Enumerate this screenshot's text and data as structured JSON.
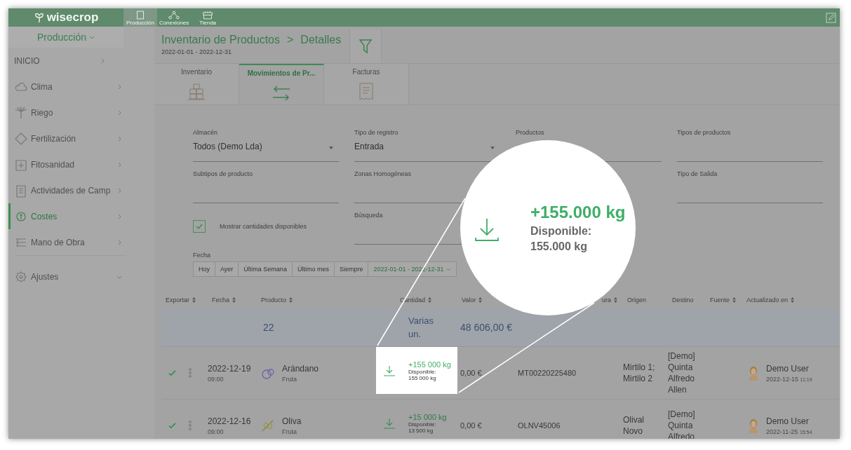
{
  "app": {
    "logo": "wisecrop"
  },
  "top_nav": [
    {
      "label": "Producción",
      "selected": true
    },
    {
      "label": "Conexiones",
      "selected": false
    },
    {
      "label": "Tienda",
      "selected": false
    }
  ],
  "sidebar": {
    "section": "Producción",
    "items": [
      {
        "label": "INICIO",
        "kind": "page",
        "selected": false
      },
      {
        "label": "Clima",
        "kind": "page",
        "selected": false
      },
      {
        "label": "Riego",
        "kind": "page",
        "selected": false
      },
      {
        "label": "Fertilización",
        "kind": "page",
        "selected": false
      },
      {
        "label": "Fitosanidad",
        "kind": "page",
        "selected": false
      },
      {
        "label": "Actividades de Camp",
        "kind": "page",
        "selected": false
      },
      {
        "label": "Costes",
        "kind": "page",
        "selected": true
      },
      {
        "label": "Mano de Obra",
        "kind": "page",
        "selected": false
      },
      {
        "label": "Ajustes",
        "kind": "group",
        "selected": false
      }
    ]
  },
  "header": {
    "title": "Inventario de Productos",
    "separator": ">",
    "subtitle": "Detalles",
    "date_range": "2022-01-01 - 2022-12-31"
  },
  "tabs": [
    {
      "label": "Inventario",
      "selected": false
    },
    {
      "label": "Movimientos de Pr...",
      "selected": true
    },
    {
      "label": "Facturas",
      "selected": false
    }
  ],
  "filters": {
    "fields": [
      {
        "label": "Almacén",
        "value": "Todos (Demo Lda)",
        "kind": "select"
      },
      {
        "label": "Tipo de registro",
        "value": "Entrada",
        "kind": "select"
      },
      {
        "label": "Productos",
        "kind": "text"
      },
      {
        "label": "Tipos de productos",
        "kind": "text"
      },
      {
        "label": "Subtipos de producto",
        "kind": "text"
      },
      {
        "label": "Zonas Homogéneas",
        "kind": "text"
      },
      {
        "label": "Tipo de Salida",
        "kind": "text"
      }
    ],
    "checkbox": {
      "label": "Mostrar cantidades disponibles",
      "checked": true
    },
    "search": {
      "label": "Búsqueda"
    },
    "date": {
      "label": "Fecha",
      "options": [
        {
          "label": "Hoy",
          "selected": false
        },
        {
          "label": "Ayer",
          "selected": false
        },
        {
          "label": "Última Semana",
          "selected": false
        },
        {
          "label": "Último mes",
          "selected": false
        },
        {
          "label": "Siempre",
          "selected": false
        },
        {
          "label": "2022-01-01 - 2022-12-31",
          "selected": true
        }
      ]
    }
  },
  "table": {
    "columns": [
      {
        "label": "Exportar",
        "sortable": true
      },
      {
        "label": "Fecha",
        "sortable": true
      },
      {
        "label": "Producto",
        "sortable": true
      },
      {
        "label": "Cantidad",
        "sortable": true
      },
      {
        "label": "Valor",
        "sortable": true
      },
      {
        "label": "ura",
        "sortable": true
      },
      {
        "label": "Origen",
        "sortable": false
      },
      {
        "label": "Destino",
        "sortable": false
      },
      {
        "label": "Fuente",
        "sortable": true
      },
      {
        "label": "Actualizado en",
        "sortable": true
      }
    ],
    "summary": {
      "count": "22",
      "quantity": "Varias un.",
      "value": "48 606,00 €"
    },
    "rows": [
      {
        "exported": true,
        "highlighted": true,
        "date": "2022-12-19",
        "time": "09:00",
        "product": "Arándano",
        "type": "Fruta",
        "quantity": "+155 000 kg",
        "available_label": "Disponible:",
        "available": "155 000 kg",
        "value": "0,00 €",
        "reference": "MT00220225480",
        "origin": "Mirtilo 1; Mirtilo 2",
        "destination": "[Demo] Quinta Alfredo Allen",
        "user": "Demo User",
        "updated_date": "2022-12-15",
        "updated_time": "11:19"
      },
      {
        "exported": true,
        "highlighted": false,
        "date": "2022-12-16",
        "time": "09:00",
        "product": "Oliva",
        "type": "Fruta",
        "quantity": "+15 000 kg",
        "available_label": "Disponible:",
        "available": "13 500 kg",
        "value": "0,00 €",
        "reference": "OLNV45006",
        "origin": "Olival Novo",
        "destination": "[Demo] Quinta Alfredo",
        "user": "Demo User",
        "updated_date": "2022-11-25",
        "updated_time": "15:54"
      }
    ]
  },
  "magnifier": {
    "quantity": "+155.000 kg",
    "available_label": "Disponible:",
    "available": "155.000 kg"
  }
}
